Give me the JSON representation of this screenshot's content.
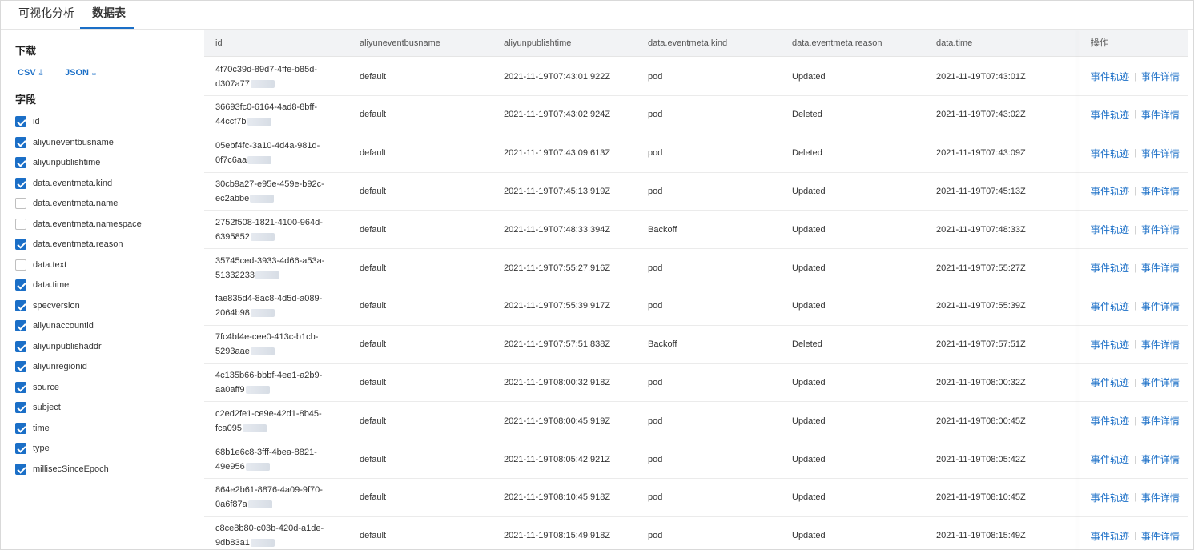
{
  "tabs": [
    {
      "label": "可视化分析",
      "active": false
    },
    {
      "label": "数据表",
      "active": true
    }
  ],
  "sidebar": {
    "download_title": "下载",
    "downloads": [
      {
        "label": "CSV",
        "icon": "download-icon"
      },
      {
        "label": "JSON",
        "icon": "download-icon"
      }
    ],
    "fields_title": "字段",
    "fields": [
      {
        "label": "id",
        "checked": true
      },
      {
        "label": "aliyuneventbusname",
        "checked": true
      },
      {
        "label": "aliyunpublishtime",
        "checked": true
      },
      {
        "label": "data.eventmeta.kind",
        "checked": true
      },
      {
        "label": "data.eventmeta.name",
        "checked": false
      },
      {
        "label": "data.eventmeta.namespace",
        "checked": false
      },
      {
        "label": "data.eventmeta.reason",
        "checked": true
      },
      {
        "label": "data.text",
        "checked": false
      },
      {
        "label": "data.time",
        "checked": true
      },
      {
        "label": "specversion",
        "checked": true
      },
      {
        "label": "aliyunaccountid",
        "checked": true
      },
      {
        "label": "aliyunpublishaddr",
        "checked": true
      },
      {
        "label": "aliyunregionid",
        "checked": true
      },
      {
        "label": "source",
        "checked": true
      },
      {
        "label": "subject",
        "checked": true
      },
      {
        "label": "time",
        "checked": true
      },
      {
        "label": "type",
        "checked": true
      },
      {
        "label": "millisecSinceEpoch",
        "checked": true
      }
    ]
  },
  "table": {
    "columns": [
      "id",
      "aliyuneventbusname",
      "aliyunpublishtime",
      "data.eventmeta.kind",
      "data.eventmeta.reason",
      "data.time",
      "操作"
    ],
    "actions": [
      "事件轨迹",
      "事件详情"
    ],
    "rows": [
      {
        "id1": "4f70c39d-89d7-4ffe-b85d-",
        "id2": "d307a77",
        "bus": "default",
        "ptime": "2021-11-19T07:43:01.922Z",
        "kind": "pod",
        "reason": "Updated",
        "time": "2021-11-19T07:43:01Z"
      },
      {
        "id1": "36693fc0-6164-4ad8-8bff-",
        "id2": "44ccf7b",
        "bus": "default",
        "ptime": "2021-11-19T07:43:02.924Z",
        "kind": "pod",
        "reason": "Deleted",
        "time": "2021-11-19T07:43:02Z"
      },
      {
        "id1": "05ebf4fc-3a10-4d4a-981d-",
        "id2": "0f7c6aa",
        "bus": "default",
        "ptime": "2021-11-19T07:43:09.613Z",
        "kind": "pod",
        "reason": "Deleted",
        "time": "2021-11-19T07:43:09Z"
      },
      {
        "id1": "30cb9a27-e95e-459e-b92c-",
        "id2": "ec2abbe",
        "bus": "default",
        "ptime": "2021-11-19T07:45:13.919Z",
        "kind": "pod",
        "reason": "Updated",
        "time": "2021-11-19T07:45:13Z"
      },
      {
        "id1": "2752f508-1821-4100-964d-",
        "id2": "6395852",
        "bus": "default",
        "ptime": "2021-11-19T07:48:33.394Z",
        "kind": "Backoff",
        "reason": "Updated",
        "time": "2021-11-19T07:48:33Z"
      },
      {
        "id1": "35745ced-3933-4d66-a53a-",
        "id2": "51332233",
        "bus": "default",
        "ptime": "2021-11-19T07:55:27.916Z",
        "kind": "pod",
        "reason": "Updated",
        "time": "2021-11-19T07:55:27Z"
      },
      {
        "id1": "fae835d4-8ac8-4d5d-a089-",
        "id2": "2064b98",
        "bus": "default",
        "ptime": "2021-11-19T07:55:39.917Z",
        "kind": "pod",
        "reason": "Updated",
        "time": "2021-11-19T07:55:39Z"
      },
      {
        "id1": "7fc4bf4e-cee0-413c-b1cb-",
        "id2": "5293aae",
        "bus": "default",
        "ptime": "2021-11-19T07:57:51.838Z",
        "kind": "Backoff",
        "reason": "Deleted",
        "time": "2021-11-19T07:57:51Z"
      },
      {
        "id1": "4c135b66-bbbf-4ee1-a2b9-",
        "id2": "aa0aff9",
        "bus": "default",
        "ptime": "2021-11-19T08:00:32.918Z",
        "kind": "pod",
        "reason": "Updated",
        "time": "2021-11-19T08:00:32Z"
      },
      {
        "id1": "c2ed2fe1-ce9e-42d1-8b45-",
        "id2": "fca095",
        "bus": "default",
        "ptime": "2021-11-19T08:00:45.919Z",
        "kind": "pod",
        "reason": "Updated",
        "time": "2021-11-19T08:00:45Z"
      },
      {
        "id1": "68b1e6c8-3fff-4bea-8821-",
        "id2": "49e956",
        "bus": "default",
        "ptime": "2021-11-19T08:05:42.921Z",
        "kind": "pod",
        "reason": "Updated",
        "time": "2021-11-19T08:05:42Z"
      },
      {
        "id1": "864e2b61-8876-4a09-9f70-",
        "id2": "0a6f87a",
        "bus": "default",
        "ptime": "2021-11-19T08:10:45.918Z",
        "kind": "pod",
        "reason": "Updated",
        "time": "2021-11-19T08:10:45Z"
      },
      {
        "id1": "c8ce8b80-c03b-420d-a1de-",
        "id2": "9db83a1",
        "bus": "default",
        "ptime": "2021-11-19T08:15:49.918Z",
        "kind": "pod",
        "reason": "Updated",
        "time": "2021-11-19T08:15:49Z"
      }
    ]
  },
  "colors": {
    "accent": "#1b6fc7",
    "header_bg": "#f2f3f5",
    "border": "#e5e5e5"
  }
}
